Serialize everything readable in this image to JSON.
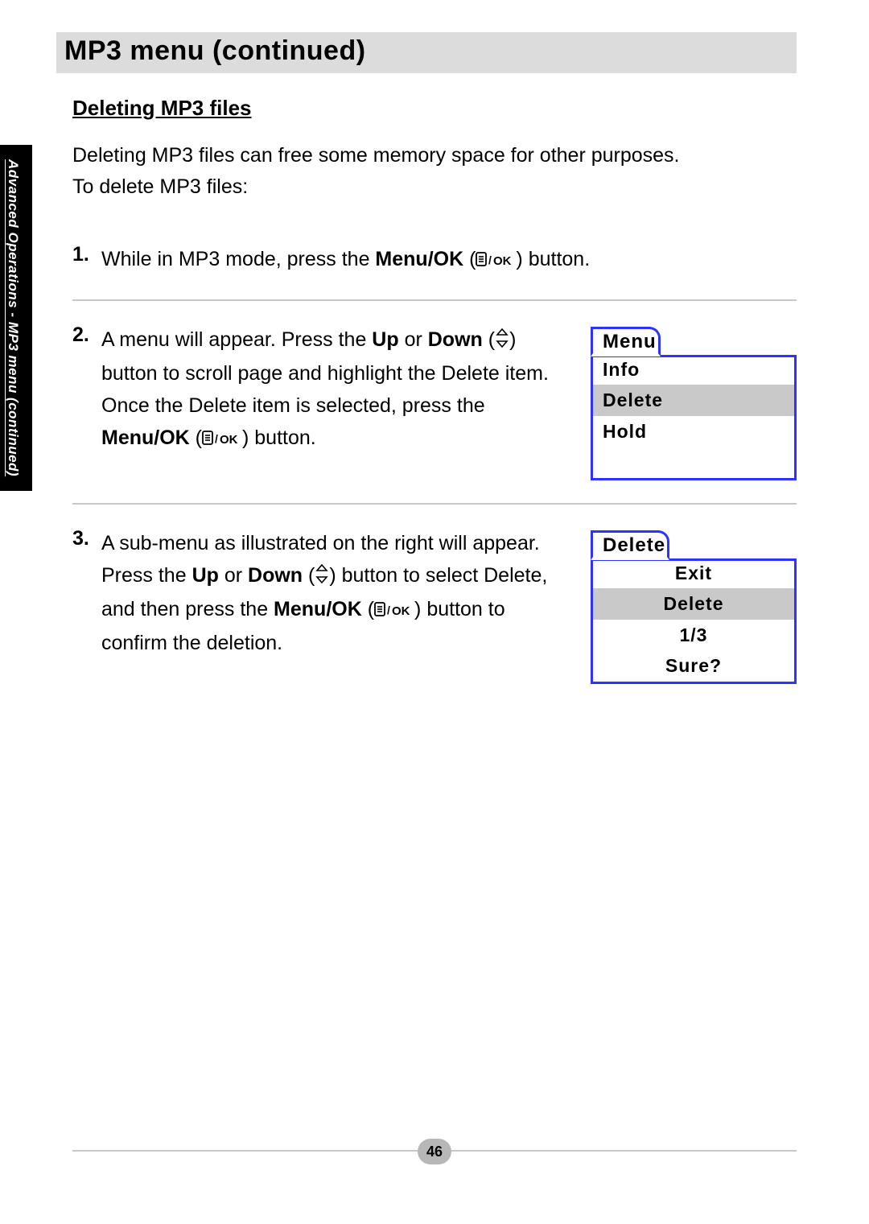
{
  "sideTab": "Advanced Operations - MP3 menu (continued)",
  "title": "MP3 menu (continued)",
  "sectionHeading": "Deleting MP3 files",
  "intro1": "Deleting MP3 files can free some memory space for other purposes.",
  "intro2": "To delete MP3 files:",
  "steps": {
    "s1": {
      "num": "1.",
      "t1": " While in MP3 mode, press the ",
      "b1": "Menu/OK",
      "t2": " (",
      "t3": ") button."
    },
    "s2": {
      "num": "2.",
      "t1": " A menu will appear. Press the ",
      "b1": "Up",
      "t2": " or ",
      "b2": "Down",
      "t3": " (",
      "t4": ") button to scroll page and highlight the Delete item. Once the Delete item is selected, press the ",
      "b3": "Menu/OK",
      "t5": " (",
      "t6": ") button."
    },
    "s3": {
      "num": "3.",
      "t1": " A sub-menu as illustrated on the right will appear. Press the ",
      "b1": "Up",
      "t2": " or ",
      "b2": "Down",
      "t3": " (",
      "t4": ") button to select Delete, and then press the ",
      "b3": "Menu/OK",
      "t5": " (",
      "t6": ") button to confirm the deletion."
    }
  },
  "uiBox1": {
    "tab": "Menu",
    "items": [
      "Info",
      "Delete",
      "Hold"
    ],
    "highlightIndex": 1
  },
  "uiBox2": {
    "tab": "Delete",
    "items": [
      "Exit",
      "Delete",
      "1/3",
      "Sure?"
    ],
    "highlightIndex": 1
  },
  "pageNumber": "46"
}
